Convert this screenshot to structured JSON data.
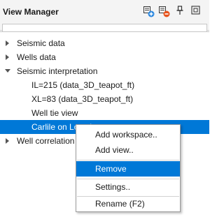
{
  "header": {
    "title": "View Manager",
    "icons": [
      "add-view-icon",
      "remove-view-icon",
      "pin-icon",
      "restore-icon"
    ]
  },
  "tree": {
    "items": [
      {
        "label": "Seismic data",
        "toggle": "collapsed"
      },
      {
        "label": "Wells data",
        "toggle": "collapsed"
      },
      {
        "label": "Seismic interpretation",
        "toggle": "expanded"
      },
      {
        "label": "IL=215 (data_3D_teapot_ft)",
        "toggle": "none"
      },
      {
        "label": "XL=83 (data_3D_teapot_ft)",
        "toggle": "none"
      },
      {
        "label": "Well tie view",
        "toggle": "none"
      },
      {
        "label": "Carlile on Location map",
        "toggle": "none",
        "selected": true
      },
      {
        "label": "Well correlation",
        "toggle": "collapsed"
      }
    ]
  },
  "context_menu": {
    "items": [
      {
        "label": "Add workspace.."
      },
      {
        "label": "Add view.."
      },
      {
        "label": "Remove",
        "highlighted": true
      },
      {
        "label": "Settings.."
      },
      {
        "label": "Rename (F2)"
      }
    ]
  },
  "colors": {
    "selection": "#0078d7",
    "add_badge": "#2f8ae0",
    "remove_badge": "#e8531c"
  }
}
